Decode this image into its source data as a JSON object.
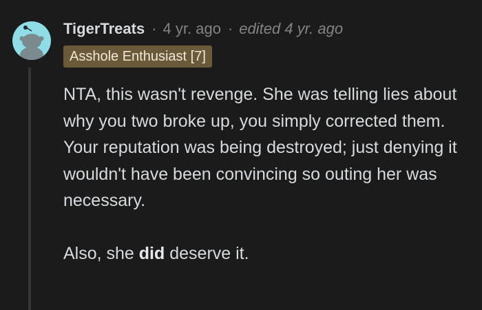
{
  "comment": {
    "author": "TigerTreats",
    "separator": "·",
    "time": "4 yr. ago",
    "edited": "edited 4 yr. ago",
    "flair": "Asshole Enthusiast [7]",
    "paragraphs": [
      "NTA, this wasn't revenge. She was telling lies about why you two broke up, you simply corrected them. Your reputation was being destroyed; just denying it wouldn't have been convincing so outing her was necessary."
    ],
    "final_paragraph": {
      "before": "Also, she ",
      "bold": "did",
      "after": " deserve it."
    }
  },
  "avatar": {
    "icon": "snoo-avatar-icon",
    "background": "#8fdde6"
  },
  "colors": {
    "page_background": "#1b1b1b",
    "text": "#d7dadc",
    "meta": "#818384",
    "flair_background": "#6b5a3a",
    "thread_line": "#343536"
  }
}
